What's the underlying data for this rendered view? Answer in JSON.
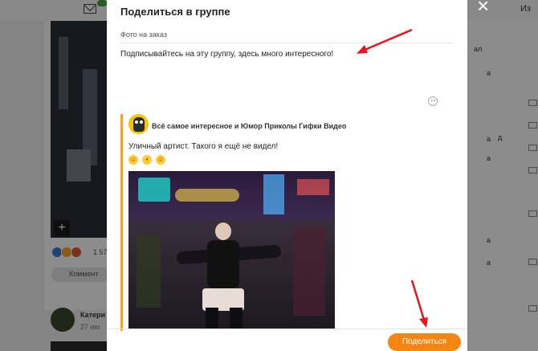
{
  "modal": {
    "title": "Поделиться в группе",
    "group_name": "Фото на заказ",
    "message": "Подписывайтесь на эту группу, здесь много интересного!",
    "share_button": "Поделиться",
    "close_icon": "×"
  },
  "post": {
    "author": "Всё самое интересное и Юмор Приколы Гифки Видео",
    "text": "Уличный артист. Такого я ещё не видел!",
    "emojis": [
      "blushing-face",
      "shushing-face",
      "smiling-face"
    ]
  },
  "background": {
    "reaction_count": "1 57",
    "comment_label": "Коммент",
    "author_name": "Катери",
    "date": "27 ию",
    "top_right_label": "Из",
    "right_column_labels": [
      "ал",
      "а",
      "а",
      "а",
      "д",
      "а",
      "а"
    ]
  },
  "colors": {
    "accent": "#f58512",
    "quote_bar": "#f7a21c",
    "annotation_arrow": "#e8141e"
  }
}
